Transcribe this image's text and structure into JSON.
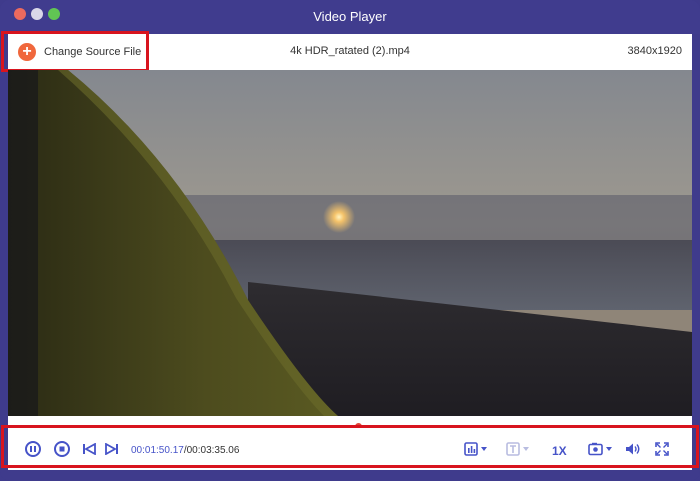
{
  "window": {
    "title": "Video Player"
  },
  "infobar": {
    "change_source_label": "Change Source File",
    "filename": "4k HDR_ratated (2).mp4",
    "resolution": "3840x1920"
  },
  "playback": {
    "current_time": "00:01:50.17",
    "total_time": "/00:03:35.06",
    "progress": 0.512,
    "speed": "1X"
  },
  "icons": {
    "close": "close-dot-icon",
    "minimize": "minimize-dot-icon",
    "maximize": "maximize-dot-icon",
    "add": "plus-circle-icon",
    "pause": "pause-icon",
    "stop": "stop-icon",
    "rewind": "rewind-icon",
    "forward": "fast-forward-icon",
    "audio_track": "audio-track-icon",
    "subtitle": "subtitle-icon",
    "snapshot": "camera-icon",
    "volume": "volume-icon",
    "fullscreen": "fullscreen-icon"
  },
  "colors": {
    "window_bg": "#3f3b8c",
    "accent": "#4653c8",
    "add_button": "#f0673c",
    "highlight": "#d8141e",
    "progress": "#e0473a"
  }
}
